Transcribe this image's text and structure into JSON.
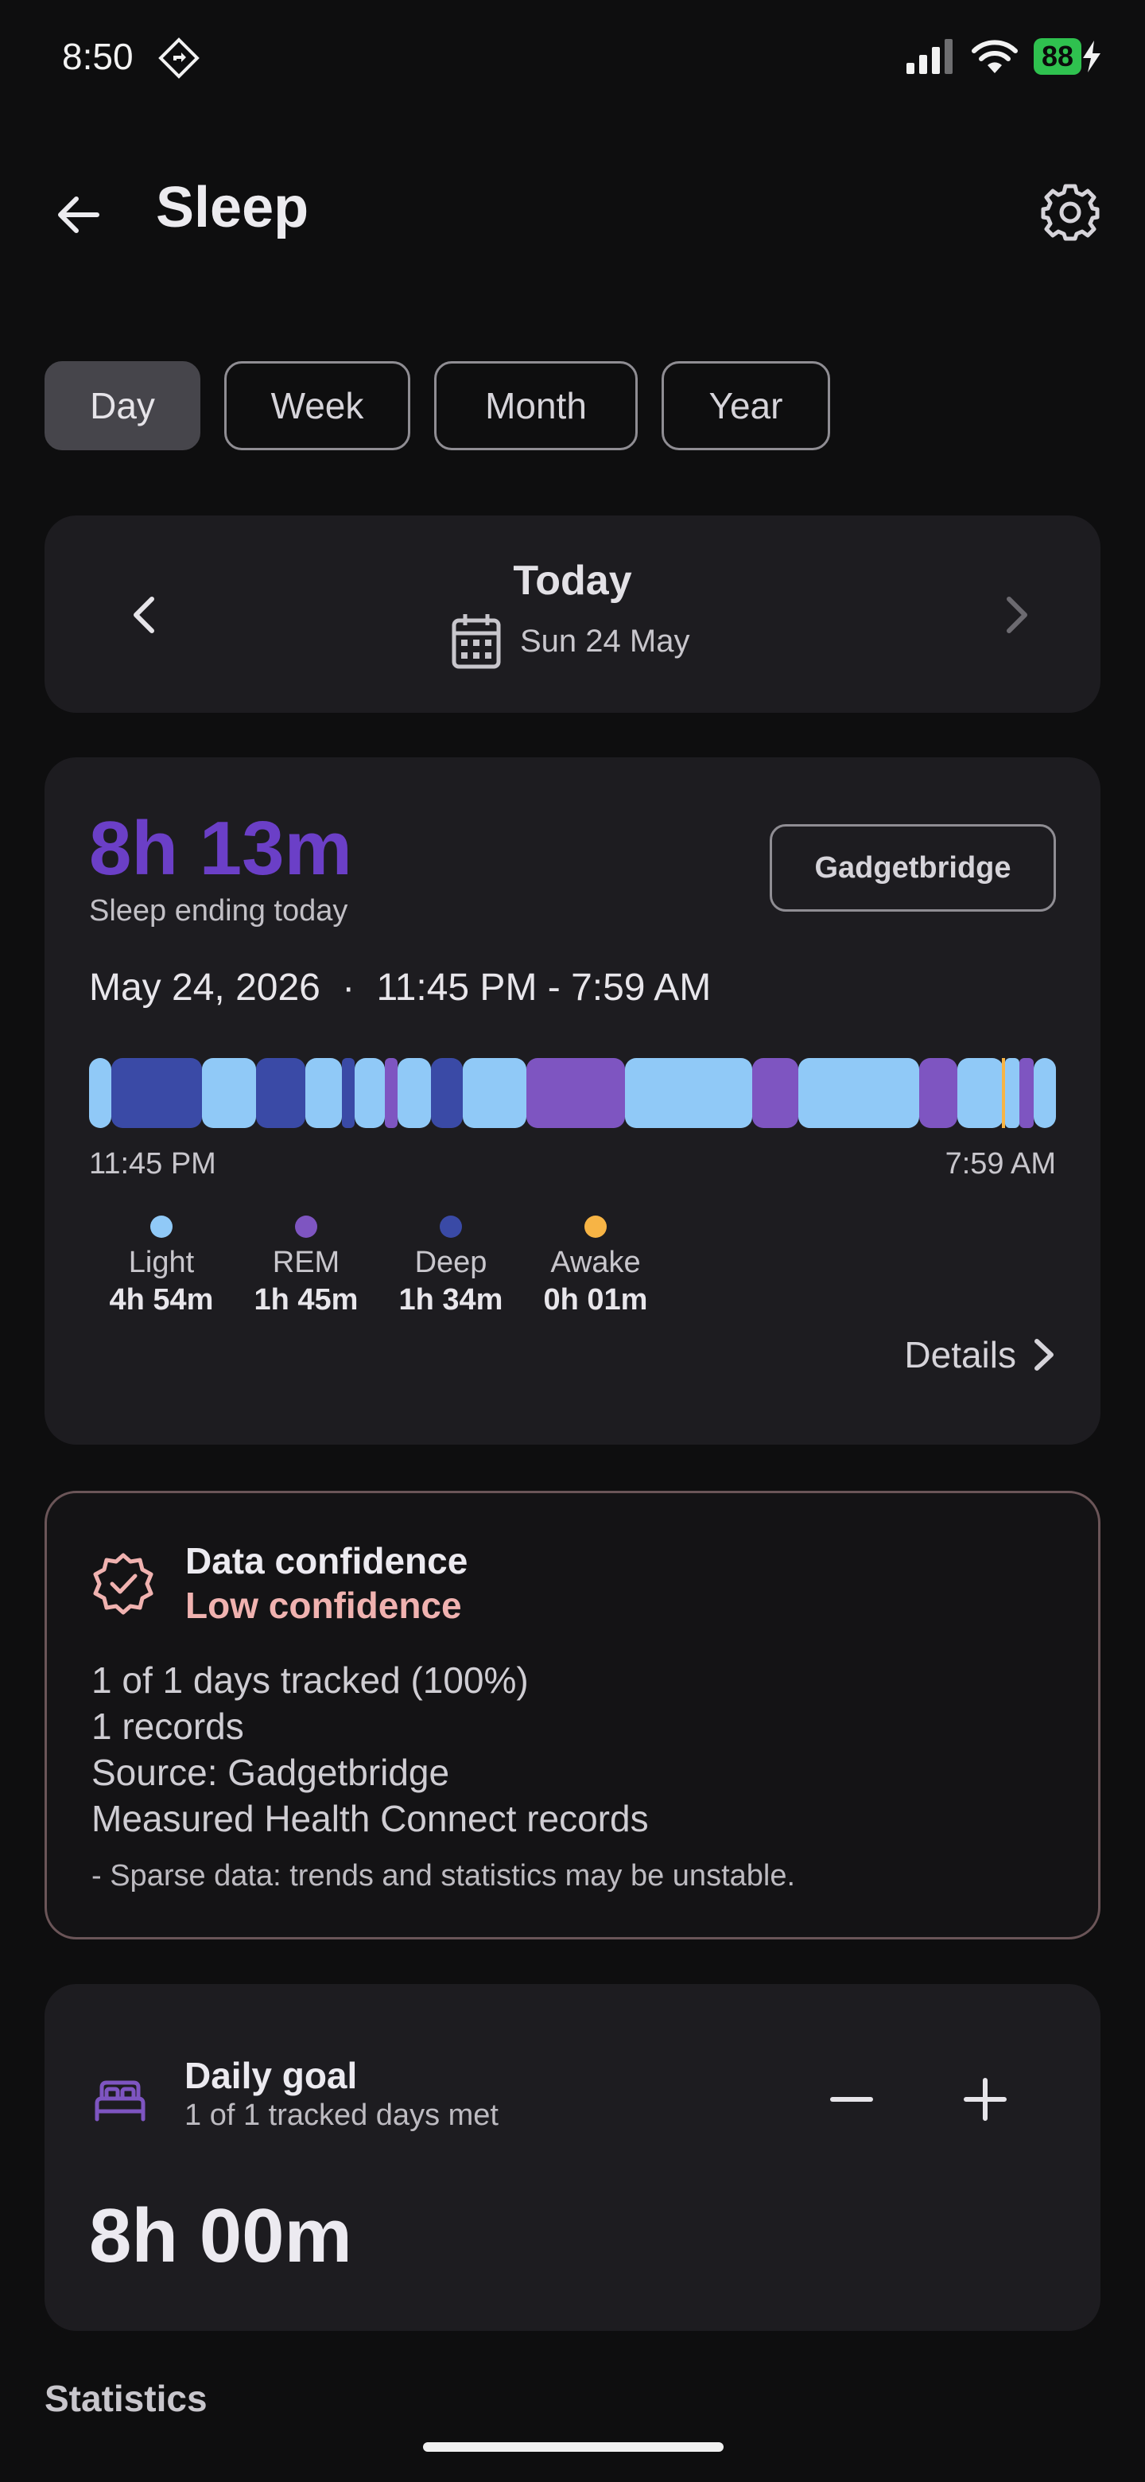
{
  "status_bar": {
    "time": "8:50",
    "battery": "88",
    "icons": [
      "navigation-app-icon",
      "signal-icon",
      "wifi-icon",
      "battery-icon",
      "charging-icon"
    ]
  },
  "header": {
    "title": "Sleep",
    "back_icon": "back-arrow-icon",
    "settings_icon": "gear-icon"
  },
  "tabs": [
    {
      "label": "Day",
      "active": true
    },
    {
      "label": "Week",
      "active": false
    },
    {
      "label": "Month",
      "active": false
    },
    {
      "label": "Year",
      "active": false
    }
  ],
  "date_nav": {
    "title": "Today",
    "date": "Sun 24 May"
  },
  "sleep": {
    "duration": "8h 13m",
    "ending_label": "Sleep ending today",
    "source": "Gadgetbridge",
    "date": "May 24, 2026",
    "separator": "·",
    "range": "11:45 PM - 7:59 AM",
    "start_time": "11:45 PM",
    "end_time": "7:59 AM",
    "stage_colors": {
      "light": "#90c9f7",
      "rem": "#7e55c1",
      "deep": "#3a4aa6",
      "awake": "#f7b445"
    },
    "stages": [
      {
        "key": "light",
        "label": "Light",
        "value": "4h 54m"
      },
      {
        "key": "rem",
        "label": "REM",
        "value": "1h 45m"
      },
      {
        "key": "deep",
        "label": "Deep",
        "value": "1h 34m"
      },
      {
        "key": "awake",
        "label": "Awake",
        "value": "0h 01m"
      }
    ],
    "details_label": "Details"
  },
  "confidence": {
    "title": "Data confidence",
    "level": "Low confidence",
    "lines": [
      "1 of 1 days tracked (100%)",
      "1 records",
      "Source: Gadgetbridge",
      "Measured Health Connect records"
    ],
    "note": "- Sparse data: trends and statistics may be unstable.",
    "accent_color": "#f0b2b0"
  },
  "goal": {
    "title": "Daily goal",
    "subtitle": "1 of 1 tracked days met",
    "value": "8h 00m",
    "icon_color": "#7e55c1"
  },
  "statistics_heading": "Statistics"
}
